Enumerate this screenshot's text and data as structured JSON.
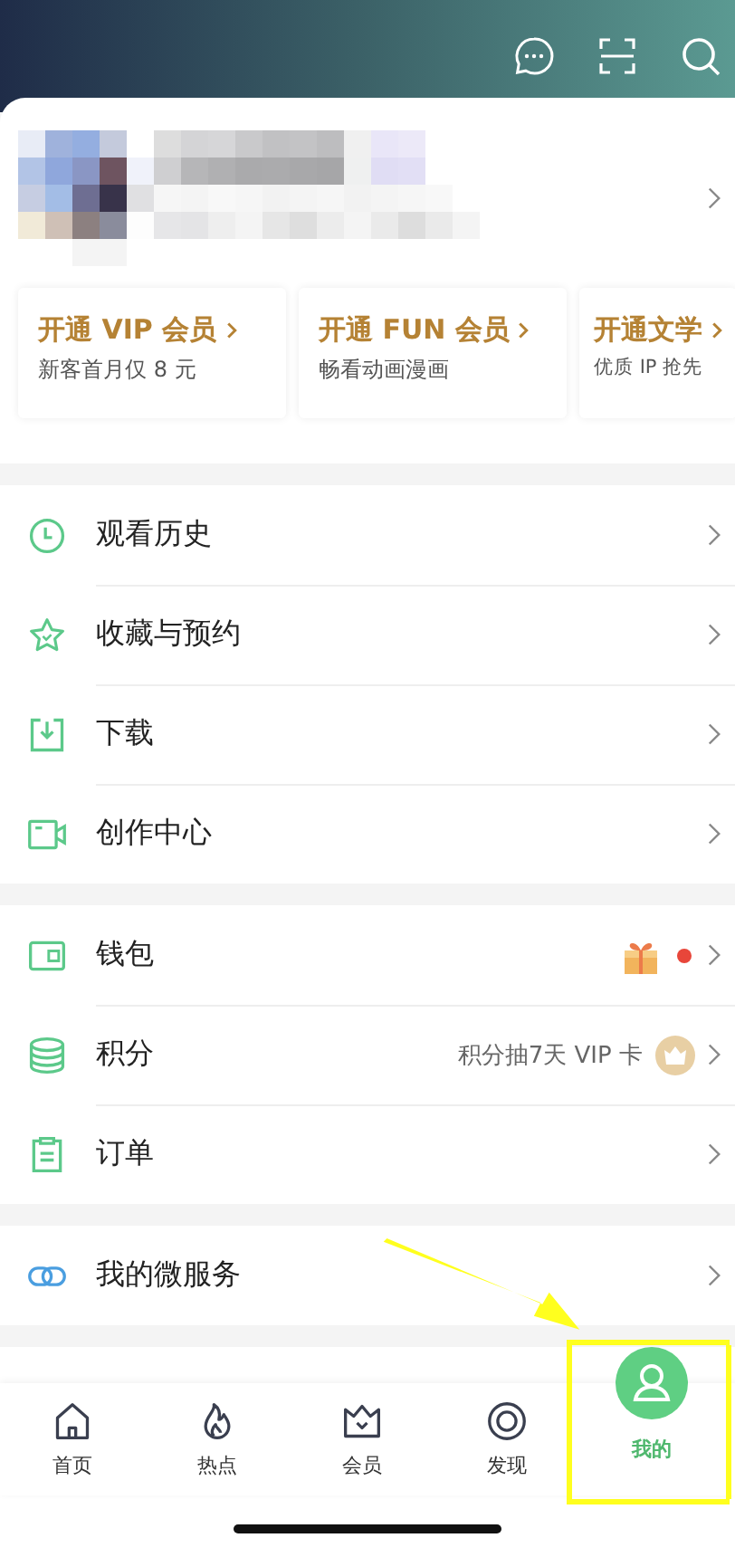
{
  "vip_cards": [
    {
      "title": "开通 VIP 会员",
      "subtitle": "新客首月仅 8 元"
    },
    {
      "title": "开通 FUN 会员",
      "subtitle": "畅看动画漫画"
    },
    {
      "title": "开通文学",
      "subtitle": "优质 IP 抢先"
    }
  ],
  "menu_groups": [
    [
      {
        "label": "观看历史"
      },
      {
        "label": "收藏与预约"
      },
      {
        "label": "下载"
      },
      {
        "label": "创作中心"
      }
    ],
    [
      {
        "label": "钱包",
        "dot": true
      },
      {
        "label": "积分",
        "note": "积分抽7天 VIP 卡"
      },
      {
        "label": "订单"
      }
    ],
    [
      {
        "label": "我的微服务"
      }
    ]
  ],
  "tabs": [
    {
      "label": "首页",
      "selected": false
    },
    {
      "label": "热点",
      "selected": false
    },
    {
      "label": "会员",
      "selected": false
    },
    {
      "label": "发现",
      "selected": false
    },
    {
      "label": "我的",
      "selected": true
    }
  ]
}
